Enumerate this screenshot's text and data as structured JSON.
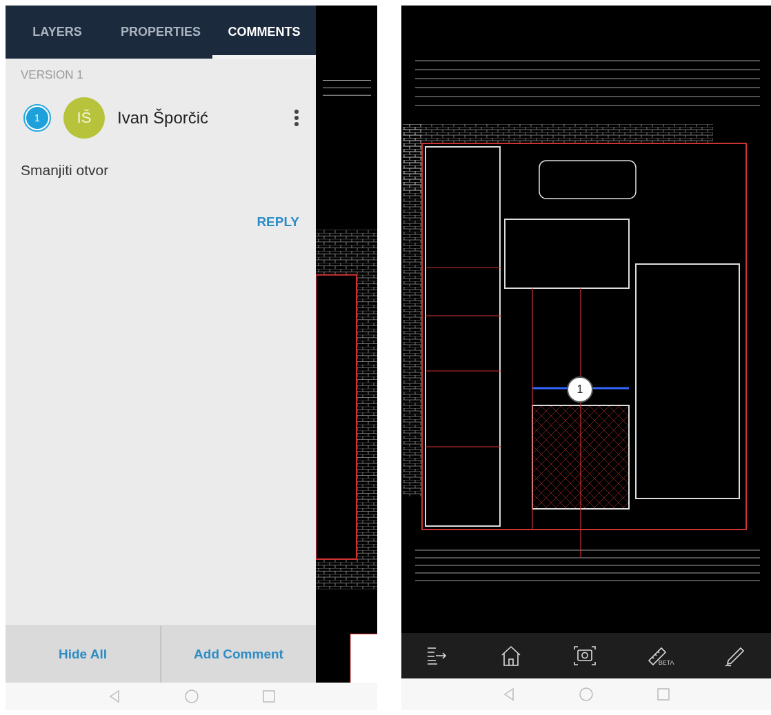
{
  "left_screen": {
    "tabs": [
      {
        "label": "LAYERS",
        "selected": false
      },
      {
        "label": "PROPERTIES",
        "selected": false
      },
      {
        "label": "COMMENTS",
        "selected": true
      }
    ],
    "version_label": "VERSION 1",
    "comment": {
      "marker": "1",
      "initials": "IŠ",
      "author": "Ivan Šporčić",
      "text": "Smanjiti otvor",
      "reply": "REPLY"
    },
    "actions": [
      "Hide All",
      "Add Comment"
    ]
  },
  "right_screen": {
    "marker": "1",
    "toolbar": [
      {
        "kind": "outline"
      },
      {
        "kind": "home"
      },
      {
        "kind": "camera"
      },
      {
        "kind": "measure",
        "label": "BETA"
      },
      {
        "kind": "markup"
      }
    ]
  }
}
